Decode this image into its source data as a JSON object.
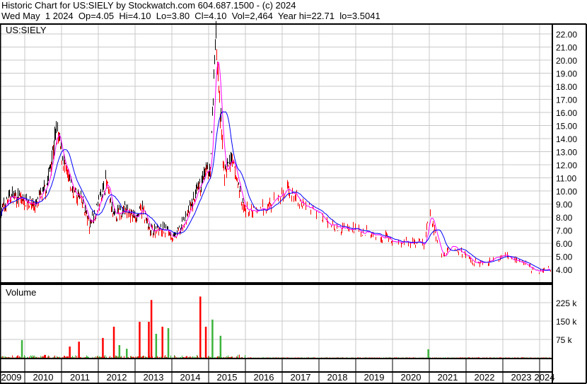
{
  "header": {
    "line1": "Historic Chart for US:SIELY by Stockwatch.com 604.687.1500 - (c) 2024",
    "line2": "Wed May  1 2024  Op=4.05  Hi=4.10  Lo=3.80  Cl=4.10  Vol=2,464  Year hi=22.71  lo=3.5041"
  },
  "chart_data": [
    {
      "type": "line",
      "title": "US:SIELY",
      "ylim": [
        3.5,
        22.8
      ],
      "yticks": [
        "22.00",
        "21.00",
        "20.00",
        "19.00",
        "18.00",
        "17.00",
        "16.00",
        "15.00",
        "14.00",
        "13.00",
        "12.00",
        "11.00",
        "10.00",
        "9.00",
        "8.00",
        "7.00",
        "6.00",
        "5.00",
        "4.00"
      ],
      "xticks": [
        "2009",
        "2010",
        "2011",
        "2012",
        "2013",
        "2014",
        "2015",
        "2016",
        "2017",
        "2018",
        "2019",
        "2020",
        "2021",
        "2022",
        "2023",
        "2024"
      ],
      "series": [
        {
          "name": "price",
          "color": "#ff0000",
          "points": [
            [
              2009.33,
              8.4
            ],
            [
              2009.6,
              9.6
            ],
            [
              2010.0,
              9.3
            ],
            [
              2010.3,
              8.9
            ],
            [
              2010.6,
              10.5
            ],
            [
              2010.85,
              14.6
            ],
            [
              2011.1,
              11.5
            ],
            [
              2011.3,
              10.0
            ],
            [
              2011.55,
              9.2
            ],
            [
              2011.75,
              7.4
            ],
            [
              2012.0,
              9.0
            ],
            [
              2012.2,
              10.8
            ],
            [
              2012.4,
              8.0
            ],
            [
              2012.7,
              8.6
            ],
            [
              2013.0,
              8.0
            ],
            [
              2013.2,
              8.6
            ],
            [
              2013.4,
              6.8
            ],
            [
              2013.6,
              7.2
            ],
            [
              2013.9,
              6.9
            ],
            [
              2014.05,
              6.3
            ],
            [
              2014.3,
              7.5
            ],
            [
              2014.55,
              9.0
            ],
            [
              2014.85,
              11.0
            ],
            [
              2015.05,
              11.8
            ],
            [
              2015.18,
              22.3
            ],
            [
              2015.3,
              16.0
            ],
            [
              2015.42,
              11.2
            ],
            [
              2015.6,
              12.4
            ],
            [
              2015.8,
              10.5
            ],
            [
              2015.95,
              8.6
            ],
            [
              2016.3,
              8.4
            ],
            [
              2016.6,
              8.7
            ],
            [
              2016.9,
              9.5
            ],
            [
              2017.2,
              10.2
            ],
            [
              2017.5,
              9.0
            ],
            [
              2017.9,
              8.6
            ],
            [
              2018.3,
              7.4
            ],
            [
              2018.7,
              7.1
            ],
            [
              2019.1,
              7.0
            ],
            [
              2019.6,
              6.6
            ],
            [
              2020.0,
              6.2
            ],
            [
              2020.5,
              6.0
            ],
            [
              2020.85,
              5.9
            ],
            [
              2021.0,
              8.3
            ],
            [
              2021.2,
              6.3
            ],
            [
              2021.35,
              4.8
            ],
            [
              2021.6,
              6.0
            ],
            [
              2021.9,
              5.2
            ],
            [
              2022.2,
              4.5
            ],
            [
              2022.6,
              4.6
            ],
            [
              2023.0,
              5.1
            ],
            [
              2023.3,
              4.7
            ],
            [
              2023.6,
              4.4
            ],
            [
              2023.9,
              3.8
            ],
            [
              2024.33,
              4.1
            ]
          ]
        },
        {
          "name": "short MA",
          "color": "#ff00ff"
        },
        {
          "name": "long MA",
          "color": "#0000ff"
        }
      ]
    },
    {
      "type": "bar",
      "title": "Volume",
      "yticks": [
        "225 k",
        "150 k",
        "75 k"
      ],
      "ylim": [
        0,
        300
      ],
      "spikes": [
        [
          2009.9,
          72,
          "green"
        ],
        [
          2011.2,
          46,
          "red"
        ],
        [
          2011.45,
          66,
          "red"
        ],
        [
          2012.1,
          81,
          "red"
        ],
        [
          2012.4,
          127,
          "red"
        ],
        [
          2012.55,
          52,
          "green"
        ],
        [
          2012.75,
          37,
          "green"
        ],
        [
          2013.1,
          147,
          "red"
        ],
        [
          2013.35,
          147,
          "red"
        ],
        [
          2013.42,
          236,
          "red"
        ],
        [
          2013.55,
          98,
          "green"
        ],
        [
          2013.72,
          127,
          "red"
        ],
        [
          2013.88,
          121,
          "green"
        ],
        [
          2014.75,
          250,
          "red"
        ],
        [
          2014.9,
          127,
          "red"
        ],
        [
          2015.08,
          156,
          "green"
        ],
        [
          2015.3,
          90,
          "green"
        ],
        [
          2020.95,
          35,
          "green"
        ]
      ]
    }
  ]
}
